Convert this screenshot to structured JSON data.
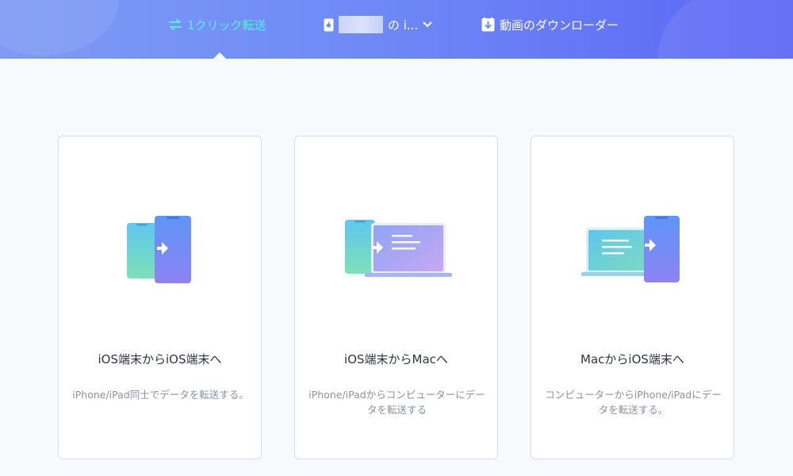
{
  "header": {
    "nav": [
      {
        "label": "1クリック転送",
        "icon": "transfer-arrows-icon",
        "active": true
      },
      {
        "label": "の i...",
        "icon": "apple-device-icon",
        "active": false
      },
      {
        "label": "動画のダウンローダー",
        "icon": "download-icon",
        "active": false
      }
    ]
  },
  "cards": [
    {
      "title": "iOS端末からiOS端末へ",
      "desc": "iPhone/iPad同士でデータを転送する。",
      "illustration": "phone-to-phone"
    },
    {
      "title": "iOS端末からMacへ",
      "desc": "iPhone/iPadからコンピューターにデータを転送する",
      "illustration": "phone-to-mac"
    },
    {
      "title": "MacからiOS端末へ",
      "desc": "コンピューターからiPhone/iPadにデータを転送する。",
      "illustration": "mac-to-phone"
    }
  ],
  "colors": {
    "header_start": "#7d9bf4",
    "header_end": "#5b66f6",
    "active_nav": "#52f0e8",
    "card_border": "#d4dcf0"
  }
}
